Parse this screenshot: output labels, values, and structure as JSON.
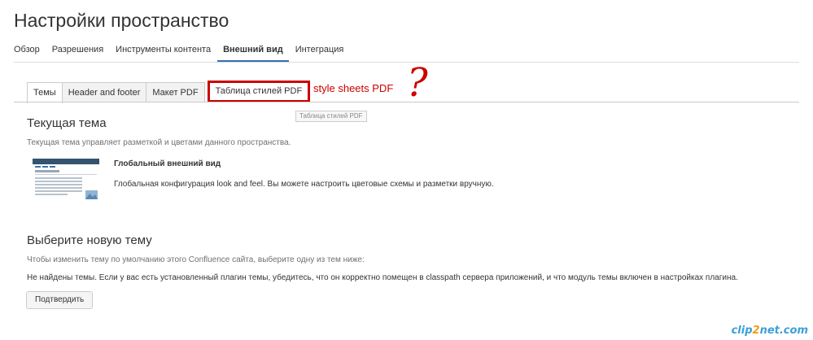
{
  "page": {
    "title": "Настройки пространство"
  },
  "main_nav": {
    "items": [
      {
        "label": "Обзор"
      },
      {
        "label": "Разрешения"
      },
      {
        "label": "Инструменты контента"
      },
      {
        "label": "Внешний вид"
      },
      {
        "label": "Интеграция"
      }
    ],
    "active_index": 3
  },
  "tabs": {
    "items": [
      {
        "label": "Темы"
      },
      {
        "label": "Header and footer"
      },
      {
        "label": "Макет PDF"
      },
      {
        "label": "Таблица стилей PDF"
      }
    ],
    "active_index": 0,
    "highlight_index": 3
  },
  "annotation": {
    "text": "style sheets PDF",
    "question_mark": "?",
    "color": "#cc0000"
  },
  "tooltip": {
    "text": "Таблица стилей PDF"
  },
  "current_theme": {
    "title": "Текущая тема",
    "description": "Текущая тема управляет разметкой и цветами данного пространства.",
    "theme_name": "Глобальный внешний вид",
    "theme_description": "Глобальная конфигурация look and feel. Вы можете настроить цветовые схемы и разметки вручную."
  },
  "choose_theme": {
    "title": "Выберите новую тему",
    "description": "Чтобы изменить тему по умолчанию этого Confluence сайта, выберите одну из тем ниже:",
    "message": "Не найдены темы. Если у вас есть установленный плагин темы, убедитесь, что он корректно помещен в classpath сервера приложений, и что модуль темы включен в настройках плагина.",
    "confirm_label": "Подтвердить"
  },
  "watermark": {
    "part1": "clip",
    "part2": "2",
    "part3": "net.com"
  },
  "colors": {
    "accent": "#3572b0",
    "highlight_border": "#cc0000"
  }
}
